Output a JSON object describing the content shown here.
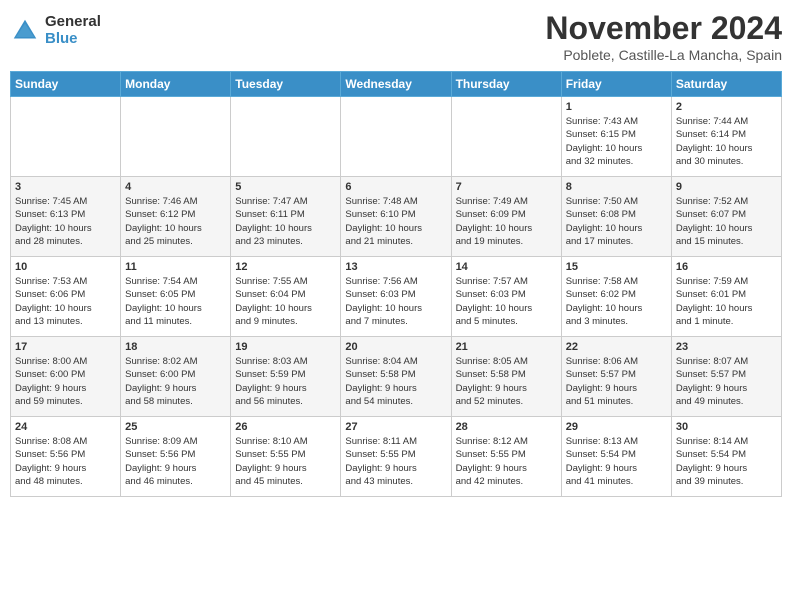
{
  "header": {
    "logo_line1": "General",
    "logo_line2": "Blue",
    "month": "November 2024",
    "location": "Poblete, Castille-La Mancha, Spain"
  },
  "weekdays": [
    "Sunday",
    "Monday",
    "Tuesday",
    "Wednesday",
    "Thursday",
    "Friday",
    "Saturday"
  ],
  "weeks": [
    [
      {
        "day": "",
        "info": ""
      },
      {
        "day": "",
        "info": ""
      },
      {
        "day": "",
        "info": ""
      },
      {
        "day": "",
        "info": ""
      },
      {
        "day": "",
        "info": ""
      },
      {
        "day": "1",
        "info": "Sunrise: 7:43 AM\nSunset: 6:15 PM\nDaylight: 10 hours\nand 32 minutes."
      },
      {
        "day": "2",
        "info": "Sunrise: 7:44 AM\nSunset: 6:14 PM\nDaylight: 10 hours\nand 30 minutes."
      }
    ],
    [
      {
        "day": "3",
        "info": "Sunrise: 7:45 AM\nSunset: 6:13 PM\nDaylight: 10 hours\nand 28 minutes."
      },
      {
        "day": "4",
        "info": "Sunrise: 7:46 AM\nSunset: 6:12 PM\nDaylight: 10 hours\nand 25 minutes."
      },
      {
        "day": "5",
        "info": "Sunrise: 7:47 AM\nSunset: 6:11 PM\nDaylight: 10 hours\nand 23 minutes."
      },
      {
        "day": "6",
        "info": "Sunrise: 7:48 AM\nSunset: 6:10 PM\nDaylight: 10 hours\nand 21 minutes."
      },
      {
        "day": "7",
        "info": "Sunrise: 7:49 AM\nSunset: 6:09 PM\nDaylight: 10 hours\nand 19 minutes."
      },
      {
        "day": "8",
        "info": "Sunrise: 7:50 AM\nSunset: 6:08 PM\nDaylight: 10 hours\nand 17 minutes."
      },
      {
        "day": "9",
        "info": "Sunrise: 7:52 AM\nSunset: 6:07 PM\nDaylight: 10 hours\nand 15 minutes."
      }
    ],
    [
      {
        "day": "10",
        "info": "Sunrise: 7:53 AM\nSunset: 6:06 PM\nDaylight: 10 hours\nand 13 minutes."
      },
      {
        "day": "11",
        "info": "Sunrise: 7:54 AM\nSunset: 6:05 PM\nDaylight: 10 hours\nand 11 minutes."
      },
      {
        "day": "12",
        "info": "Sunrise: 7:55 AM\nSunset: 6:04 PM\nDaylight: 10 hours\nand 9 minutes."
      },
      {
        "day": "13",
        "info": "Sunrise: 7:56 AM\nSunset: 6:03 PM\nDaylight: 10 hours\nand 7 minutes."
      },
      {
        "day": "14",
        "info": "Sunrise: 7:57 AM\nSunset: 6:03 PM\nDaylight: 10 hours\nand 5 minutes."
      },
      {
        "day": "15",
        "info": "Sunrise: 7:58 AM\nSunset: 6:02 PM\nDaylight: 10 hours\nand 3 minutes."
      },
      {
        "day": "16",
        "info": "Sunrise: 7:59 AM\nSunset: 6:01 PM\nDaylight: 10 hours\nand 1 minute."
      }
    ],
    [
      {
        "day": "17",
        "info": "Sunrise: 8:00 AM\nSunset: 6:00 PM\nDaylight: 9 hours\nand 59 minutes."
      },
      {
        "day": "18",
        "info": "Sunrise: 8:02 AM\nSunset: 6:00 PM\nDaylight: 9 hours\nand 58 minutes."
      },
      {
        "day": "19",
        "info": "Sunrise: 8:03 AM\nSunset: 5:59 PM\nDaylight: 9 hours\nand 56 minutes."
      },
      {
        "day": "20",
        "info": "Sunrise: 8:04 AM\nSunset: 5:58 PM\nDaylight: 9 hours\nand 54 minutes."
      },
      {
        "day": "21",
        "info": "Sunrise: 8:05 AM\nSunset: 5:58 PM\nDaylight: 9 hours\nand 52 minutes."
      },
      {
        "day": "22",
        "info": "Sunrise: 8:06 AM\nSunset: 5:57 PM\nDaylight: 9 hours\nand 51 minutes."
      },
      {
        "day": "23",
        "info": "Sunrise: 8:07 AM\nSunset: 5:57 PM\nDaylight: 9 hours\nand 49 minutes."
      }
    ],
    [
      {
        "day": "24",
        "info": "Sunrise: 8:08 AM\nSunset: 5:56 PM\nDaylight: 9 hours\nand 48 minutes."
      },
      {
        "day": "25",
        "info": "Sunrise: 8:09 AM\nSunset: 5:56 PM\nDaylight: 9 hours\nand 46 minutes."
      },
      {
        "day": "26",
        "info": "Sunrise: 8:10 AM\nSunset: 5:55 PM\nDaylight: 9 hours\nand 45 minutes."
      },
      {
        "day": "27",
        "info": "Sunrise: 8:11 AM\nSunset: 5:55 PM\nDaylight: 9 hours\nand 43 minutes."
      },
      {
        "day": "28",
        "info": "Sunrise: 8:12 AM\nSunset: 5:55 PM\nDaylight: 9 hours\nand 42 minutes."
      },
      {
        "day": "29",
        "info": "Sunrise: 8:13 AM\nSunset: 5:54 PM\nDaylight: 9 hours\nand 41 minutes."
      },
      {
        "day": "30",
        "info": "Sunrise: 8:14 AM\nSunset: 5:54 PM\nDaylight: 9 hours\nand 39 minutes."
      }
    ]
  ]
}
